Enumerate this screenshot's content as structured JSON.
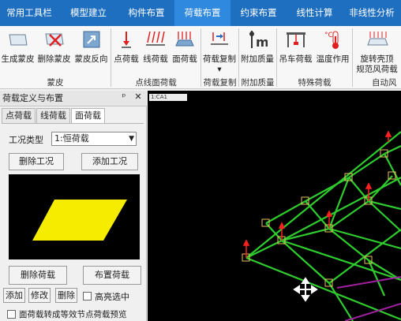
{
  "tabs": [
    {
      "label": "常用工具栏"
    },
    {
      "label": "模型建立"
    },
    {
      "label": "构件布置"
    },
    {
      "label": "荷载布置"
    },
    {
      "label": "约束布置"
    },
    {
      "label": "线性计算"
    },
    {
      "label": "非线性分析"
    }
  ],
  "ribbon": {
    "buttons": [
      {
        "label": "生成蒙皮"
      },
      {
        "label": "删除蒙皮"
      },
      {
        "label": "蒙皮反向"
      },
      {
        "label": "点荷载"
      },
      {
        "label": "线荷载"
      },
      {
        "label": "面荷载"
      },
      {
        "label": "荷载复制"
      },
      {
        "label": "附加质量"
      },
      {
        "label": "吊车荷载"
      },
      {
        "label": "温度作用"
      },
      {
        "label": "旋转壳顶",
        "label2": "规范风荷载"
      }
    ],
    "groups": [
      {
        "label": "蒙皮"
      },
      {
        "label": "点线面荷载"
      },
      {
        "label": "荷载复制"
      },
      {
        "label": "附加质量"
      },
      {
        "label": "特殊荷载"
      },
      {
        "label": "自动风"
      }
    ]
  },
  "panel": {
    "title": "荷载定义与布置",
    "pin_glyph": "ᵖ",
    "close_glyph": "✕",
    "tabs": [
      {
        "label": "点荷载"
      },
      {
        "label": "线荷载"
      },
      {
        "label": "面荷载"
      }
    ],
    "case_type_label": "工况类型",
    "case_type_value": "1:恒荷载",
    "delete_case": "删除工况",
    "add_case": "添加工况",
    "delete_load": "删除荷载",
    "place_load": "布置荷载",
    "add": "添加",
    "modify": "修改",
    "delete": "删除",
    "highlight_label": "高亮选中",
    "convert_label": "面荷载转成等效节点荷载预览"
  },
  "viewport": {
    "title": "1:CA1"
  },
  "colors": {
    "tabbar": "#1f6fc0",
    "tab_active": "#2f89de",
    "member_green": "#2ecc2e",
    "node_orange": "#e8c060",
    "load_red": "#ff2020",
    "preview_fill": "#f5ec00"
  }
}
